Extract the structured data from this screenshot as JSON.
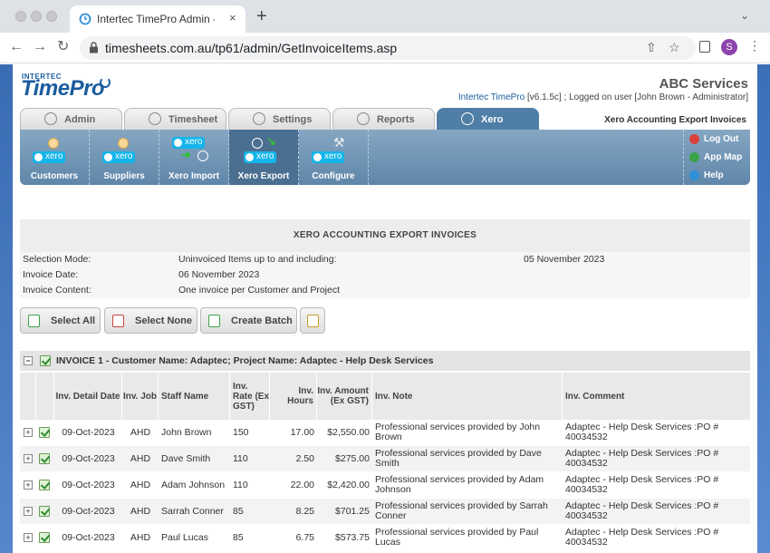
{
  "browser": {
    "tab_title": "Intertec TimePro Admin - Xero",
    "tab_close": "×",
    "new_tab": "+",
    "tab_menu": "⌄",
    "url": "timesheets.com.au/tp61/admin/GetInvoiceItems.asp",
    "avatar_letter": "S"
  },
  "app": {
    "logo_small": "INTERTEC",
    "logo": "TimePro",
    "company": "ABC Services",
    "version_link": "Intertec TimePro",
    "version_text": " [v6.1.5c] ; Logged on user [John Brown - Administrator]",
    "current_page": "Xero Accounting Export Invoices"
  },
  "main_tabs": [
    {
      "label": "Admin"
    },
    {
      "label": "Timesheet"
    },
    {
      "label": "Settings"
    },
    {
      "label": "Reports"
    },
    {
      "label": "Xero"
    }
  ],
  "sub_menu": [
    {
      "label": "Customers",
      "badge": "xero"
    },
    {
      "label": "Suppliers",
      "badge": "xero"
    },
    {
      "label": "Xero Import",
      "badge": "xero"
    },
    {
      "label": "Xero Export",
      "badge": "xero"
    },
    {
      "label": "Configure",
      "badge": "xero"
    }
  ],
  "quick_links": [
    {
      "label": "Log Out",
      "icon": "logout-icon",
      "color": "#d9413a"
    },
    {
      "label": "App Map",
      "icon": "map-icon",
      "color": "#3aa34a"
    },
    {
      "label": "Help",
      "icon": "help-icon",
      "color": "#2f8fd8"
    }
  ],
  "section": {
    "title": "XERO ACCOUNTING EXPORT INVOICES",
    "selection_mode_label": "Selection Mode:",
    "selection_mode_value": "Uninvoiced Items up to and including:",
    "selection_mode_date": "05 November 2023",
    "invoice_date_label": "Invoice Date:",
    "invoice_date_value": "06 November 2023",
    "invoice_content_label": "Invoice Content:",
    "invoice_content_value": "One invoice per Customer and Project"
  },
  "buttons": {
    "select_all": "Select All",
    "select_none": "Select None",
    "create_batch": "Create Batch"
  },
  "invoice": {
    "header": "INVOICE 1 - Customer Name: Adaptec; Project Name: Adaptec - Help Desk Services",
    "collapse": "−",
    "expand": "+",
    "columns": [
      "Inv. Detail Date",
      "Inv. Job",
      "Staff Name",
      "Inv. Rate (Ex GST)",
      "Inv. Hours",
      "Inv. Amount (Ex GST)",
      "Inv. Note",
      "Inv. Comment"
    ],
    "rows": [
      {
        "date": "09-Oct-2023",
        "job": "AHD",
        "staff": "John Brown",
        "rate": "150",
        "hours": "17.00",
        "amount": "$2,550.00",
        "note": "Professional services provided by John Brown",
        "comment": "Adaptec - Help Desk Services :PO # 40034532"
      },
      {
        "date": "09-Oct-2023",
        "job": "AHD",
        "staff": "Dave Smith",
        "rate": "110",
        "hours": "2.50",
        "amount": "$275.00",
        "note": "Professional services provided by Dave Smith",
        "comment": "Adaptec - Help Desk Services :PO # 40034532"
      },
      {
        "date": "09-Oct-2023",
        "job": "AHD",
        "staff": "Adam Johnson",
        "rate": "110",
        "hours": "22.00",
        "amount": "$2,420.00",
        "note": "Professional services provided by Adam Johnson",
        "comment": "Adaptec - Help Desk Services :PO # 40034532"
      },
      {
        "date": "09-Oct-2023",
        "job": "AHD",
        "staff": "Sarrah Conner",
        "rate": "85",
        "hours": "8.25",
        "amount": "$701.25",
        "note": "Professional services provided by Sarrah Conner",
        "comment": "Adaptec - Help Desk Services :PO # 40034532"
      },
      {
        "date": "09-Oct-2023",
        "job": "AHD",
        "staff": "Paul Lucas",
        "rate": "85",
        "hours": "6.75",
        "amount": "$573.75",
        "note": "Professional services provided by Paul Lucas",
        "comment": "Adaptec - Help Desk Services :PO # 40034532"
      }
    ]
  }
}
